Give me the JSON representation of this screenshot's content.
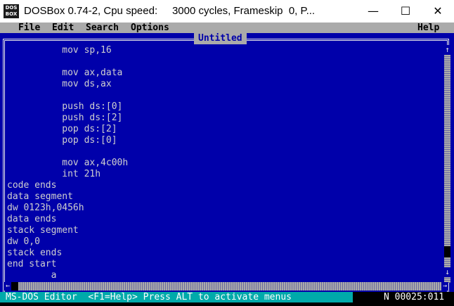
{
  "window": {
    "title": "DOSBox 0.74-2, Cpu speed:     3000 cycles, Frameskip  0, P...",
    "icon_text_top": "DOS",
    "icon_text_bottom": "BOX",
    "minimize": "—",
    "maximize": "☐",
    "close": "✕"
  },
  "menu": {
    "file": "File",
    "edit": "Edit",
    "search": "Search",
    "options": "Options",
    "help": "Help"
  },
  "document": {
    "title": "Untitled"
  },
  "code_lines": [
    "          mov sp,16",
    "",
    "          mov ax,data",
    "          mov ds,ax",
    "",
    "          push ds:[0]",
    "          push ds:[2]",
    "          pop ds:[2]",
    "          pop ds:[0]",
    "",
    "          mov ax,4c00h",
    "          int 21h",
    "code ends",
    "data segment",
    "dw 0123h,0456h",
    "data ends",
    "stack segment",
    "dw 0,0",
    "stack ends",
    "end start",
    "        a"
  ],
  "scrollbar": {
    "up_arrow": "↑",
    "down_arrow": "↓",
    "left_arrow": "←",
    "right_arrow": "→"
  },
  "status": {
    "left": "MS-DOS Editor  <F1=Help> Press ALT to activate menus",
    "right": "N 00025:011"
  },
  "colors": {
    "dos_blue": "#0000aa",
    "menu_gray": "#aaaaaa",
    "status_cyan": "#00aaaa",
    "text_gray": "#cfcfcf"
  }
}
